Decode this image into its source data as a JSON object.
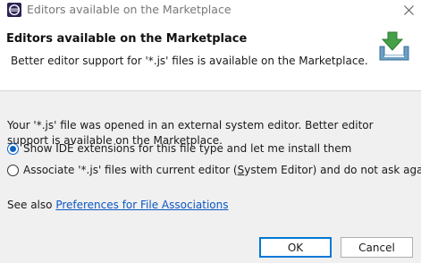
{
  "window": {
    "title": "Editors available on the Marketplace",
    "app_icon": "eclipse-icon",
    "close_icon": "close-icon"
  },
  "header": {
    "title": "Editors available on the Marketplace",
    "message": "Better editor support for '*.js' files is available on the Marketplace.",
    "icon": "marketplace-download-icon"
  },
  "content": {
    "description": "Your '*.js' file was opened in an external system editor. Better editor support is available on the Marketplace.",
    "options": [
      {
        "label": "Show IDE extensions for this file type and let me install them",
        "selected": true
      },
      {
        "label_before": "Associate '*.js' files with current editor (",
        "mnemonic": "S",
        "label_after": "ystem Editor) and do not ask again",
        "selected": false
      }
    ],
    "see_also_prefix": "See also",
    "see_also_link": "Preferences for File Associations"
  },
  "buttons": {
    "ok": "OK",
    "cancel": "Cancel"
  },
  "colors": {
    "accent": "#0b64c0",
    "link": "#0b57c5",
    "content_bg": "#f0f0f0"
  }
}
